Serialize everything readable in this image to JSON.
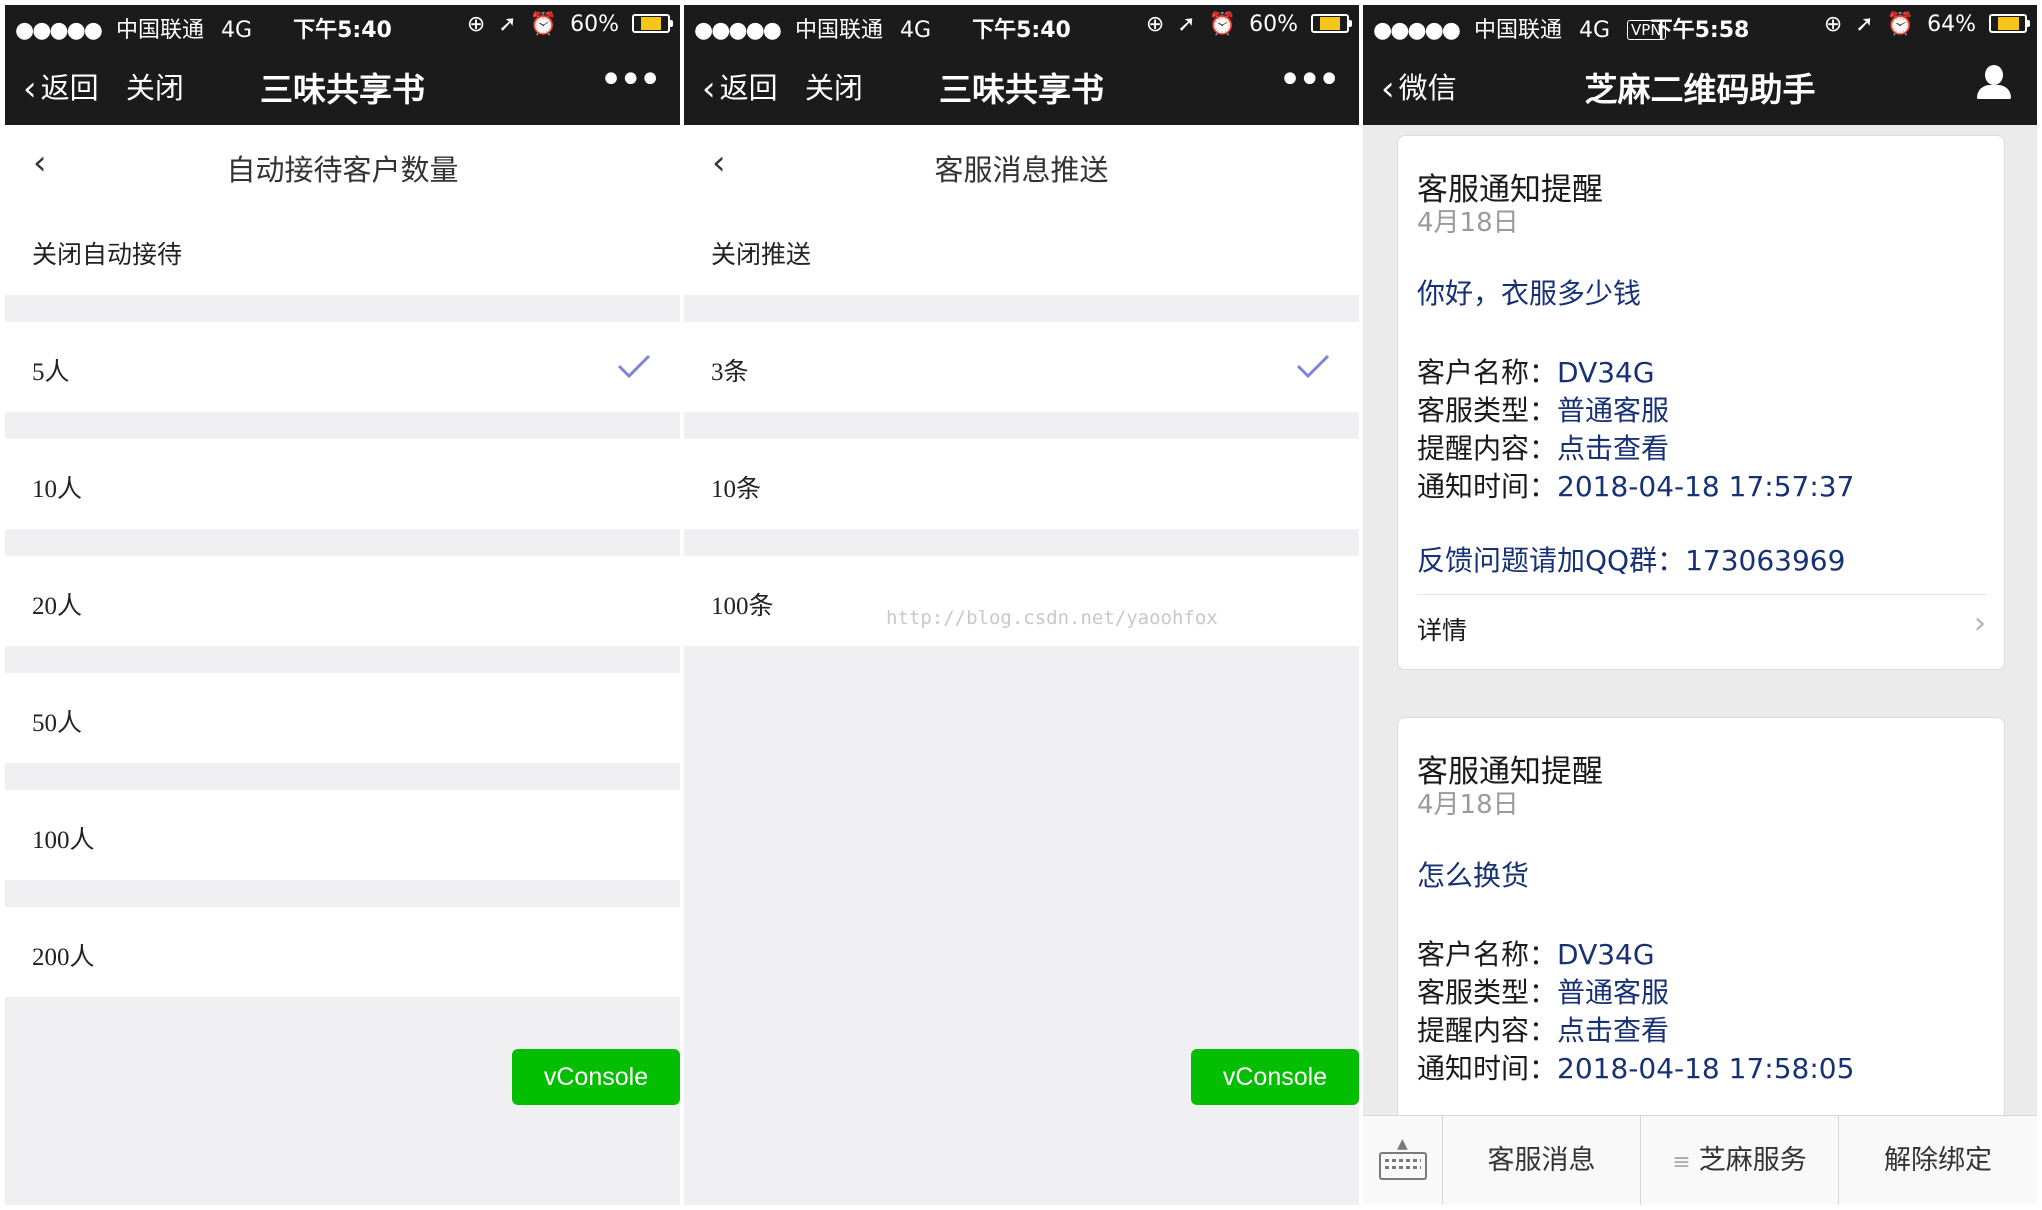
{
  "screens": [
    {
      "status": {
        "carrier": "中国联通",
        "network": "4G",
        "time": "下午5:40",
        "battery": "60%",
        "battery_level": 0.6
      },
      "nav": {
        "back_label": "返回",
        "close_label": "关闭",
        "title": "三味共享书"
      },
      "page": {
        "title": "自动接待客户数量",
        "options": [
          {
            "label": "关闭自动接待",
            "selected": false
          },
          {
            "label": "5人",
            "selected": true
          },
          {
            "label": "10人",
            "selected": false
          },
          {
            "label": "20人",
            "selected": false
          },
          {
            "label": "50人",
            "selected": false
          },
          {
            "label": "100人",
            "selected": false
          },
          {
            "label": "200人",
            "selected": false
          }
        ]
      },
      "vconsole_label": "vConsole"
    },
    {
      "status": {
        "carrier": "中国联通",
        "network": "4G",
        "time": "下午5:40",
        "battery": "60%",
        "battery_level": 0.6
      },
      "nav": {
        "back_label": "返回",
        "close_label": "关闭",
        "title": "三味共享书"
      },
      "page": {
        "title": "客服消息推送",
        "options": [
          {
            "label": "关闭推送",
            "selected": false
          },
          {
            "label": "3条",
            "selected": true
          },
          {
            "label": "10条",
            "selected": false
          },
          {
            "label": "100条",
            "selected": false
          }
        ]
      },
      "vconsole_label": "vConsole",
      "watermark": "http://blog.csdn.net/yaoohfox"
    },
    {
      "status": {
        "carrier": "中国联通",
        "network": "4G",
        "vpn": "VPN",
        "time": "下午5:58",
        "battery": "64%",
        "battery_level": 0.64
      },
      "nav": {
        "back_label": "微信",
        "title": "芝麻二维码助手"
      },
      "cards": [
        {
          "title": "客服通知提醒",
          "date": "4月18日",
          "first": "你好，衣服多少钱",
          "fields": [
            {
              "key": "客户名称：",
              "value": "DV34G"
            },
            {
              "key": "客服类型：",
              "value": "普通客服"
            },
            {
              "key": "提醒内容：",
              "value": "点击查看"
            },
            {
              "key": "通知时间：",
              "value": "2018-04-18 17:57:37"
            }
          ],
          "remark": "反馈问题请加QQ群：173063969",
          "detail_label": "详情"
        },
        {
          "title": "客服通知提醒",
          "date": "4月18日",
          "first": "怎么换货",
          "fields": [
            {
              "key": "客户名称：",
              "value": "DV34G"
            },
            {
              "key": "客服类型：",
              "value": "普通客服"
            },
            {
              "key": "提醒内容：",
              "value": "点击查看"
            },
            {
              "key": "通知时间：",
              "value": "2018-04-18 17:58:05"
            }
          ]
        }
      ],
      "menu": [
        "客服消息",
        "芝麻服务",
        "解除绑定"
      ]
    }
  ],
  "colors": {
    "nav_bg": "#1b1b1b",
    "check": "#7b86d6",
    "vconsole": "#04be02",
    "template_value": "#173177"
  },
  "icons": [
    "back-chevron-icon",
    "more-dots-icon",
    "check-icon",
    "user-icon",
    "keyboard-icon",
    "chevron-right-icon",
    "battery-icon"
  ]
}
